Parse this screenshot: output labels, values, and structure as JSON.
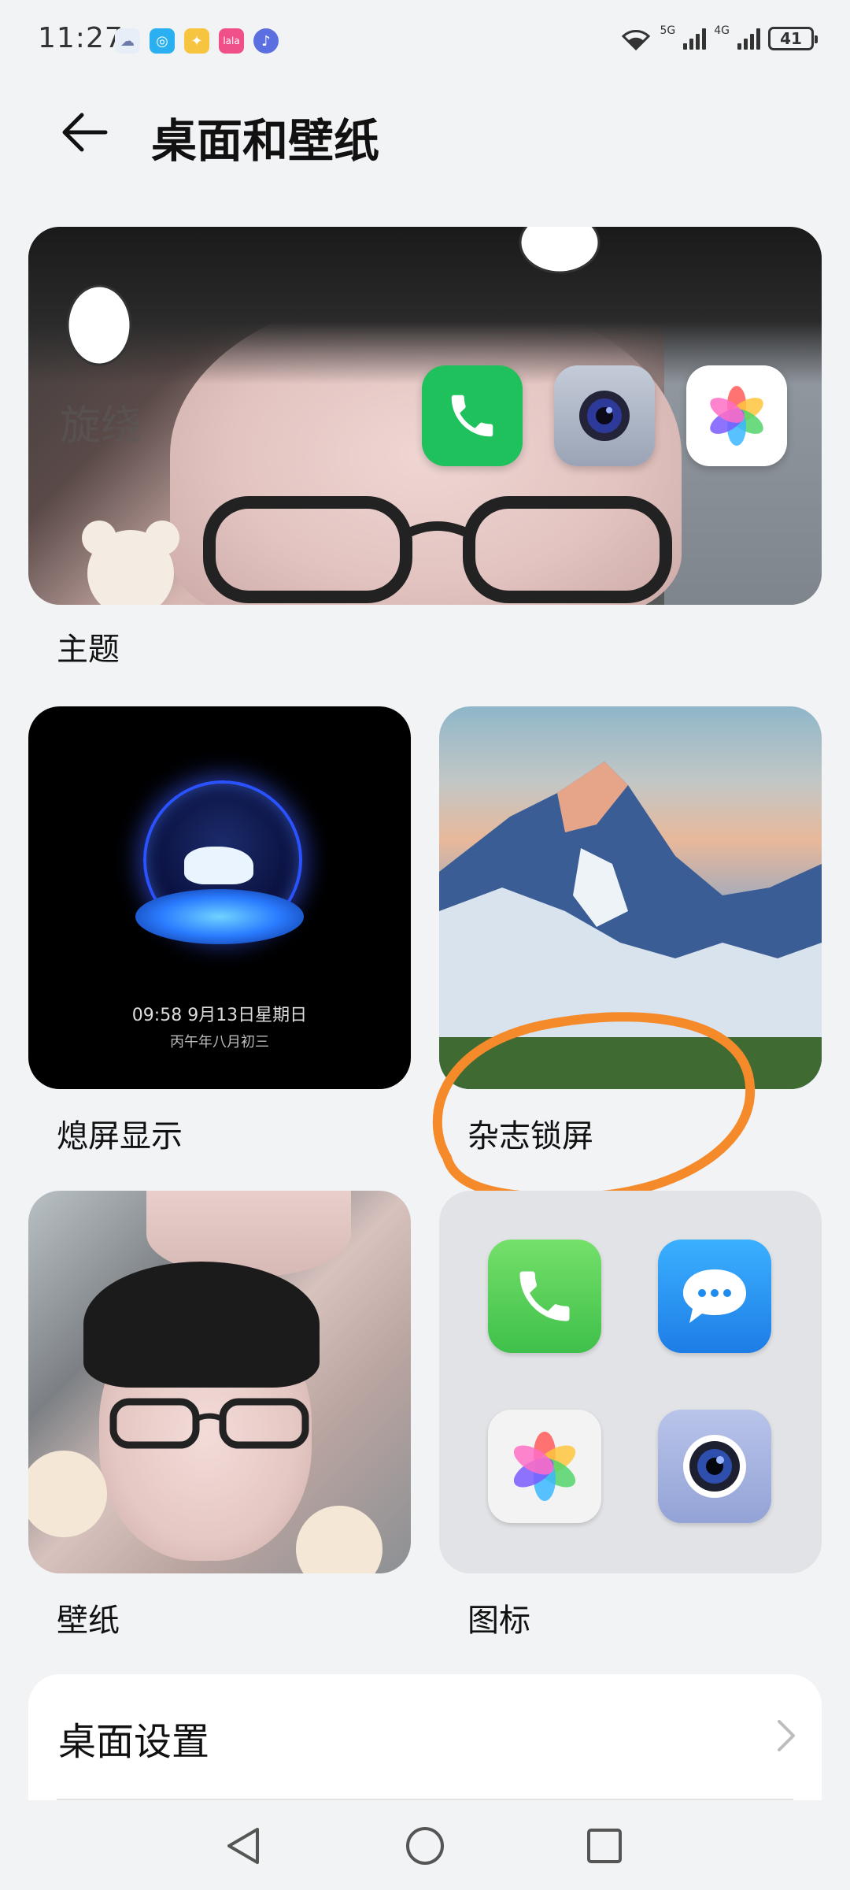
{
  "status_bar": {
    "time": "11:27",
    "network_label_1": "5G",
    "network_label_2": "4G",
    "battery": "41"
  },
  "header": {
    "title": "桌面和壁纸"
  },
  "theme": {
    "label": "主题",
    "watermark": "旋绕"
  },
  "aod": {
    "label": "熄屏显示",
    "time_line": "09:58  9月13日星期日",
    "lunar_line": "丙午年八月初三"
  },
  "magazine_lock": {
    "label": "杂志锁屏"
  },
  "wallpaper": {
    "label": "壁纸"
  },
  "icons": {
    "label": "图标"
  },
  "settings": {
    "desktop_settings": "桌面设置"
  },
  "colors": {
    "annotation": "#f58a2b",
    "phone_green": "#1ec15b",
    "message_blue": "#1d8cf0"
  },
  "icon_names": [
    "phone-icon",
    "camera-icon",
    "gallery-icon",
    "message-icon"
  ]
}
